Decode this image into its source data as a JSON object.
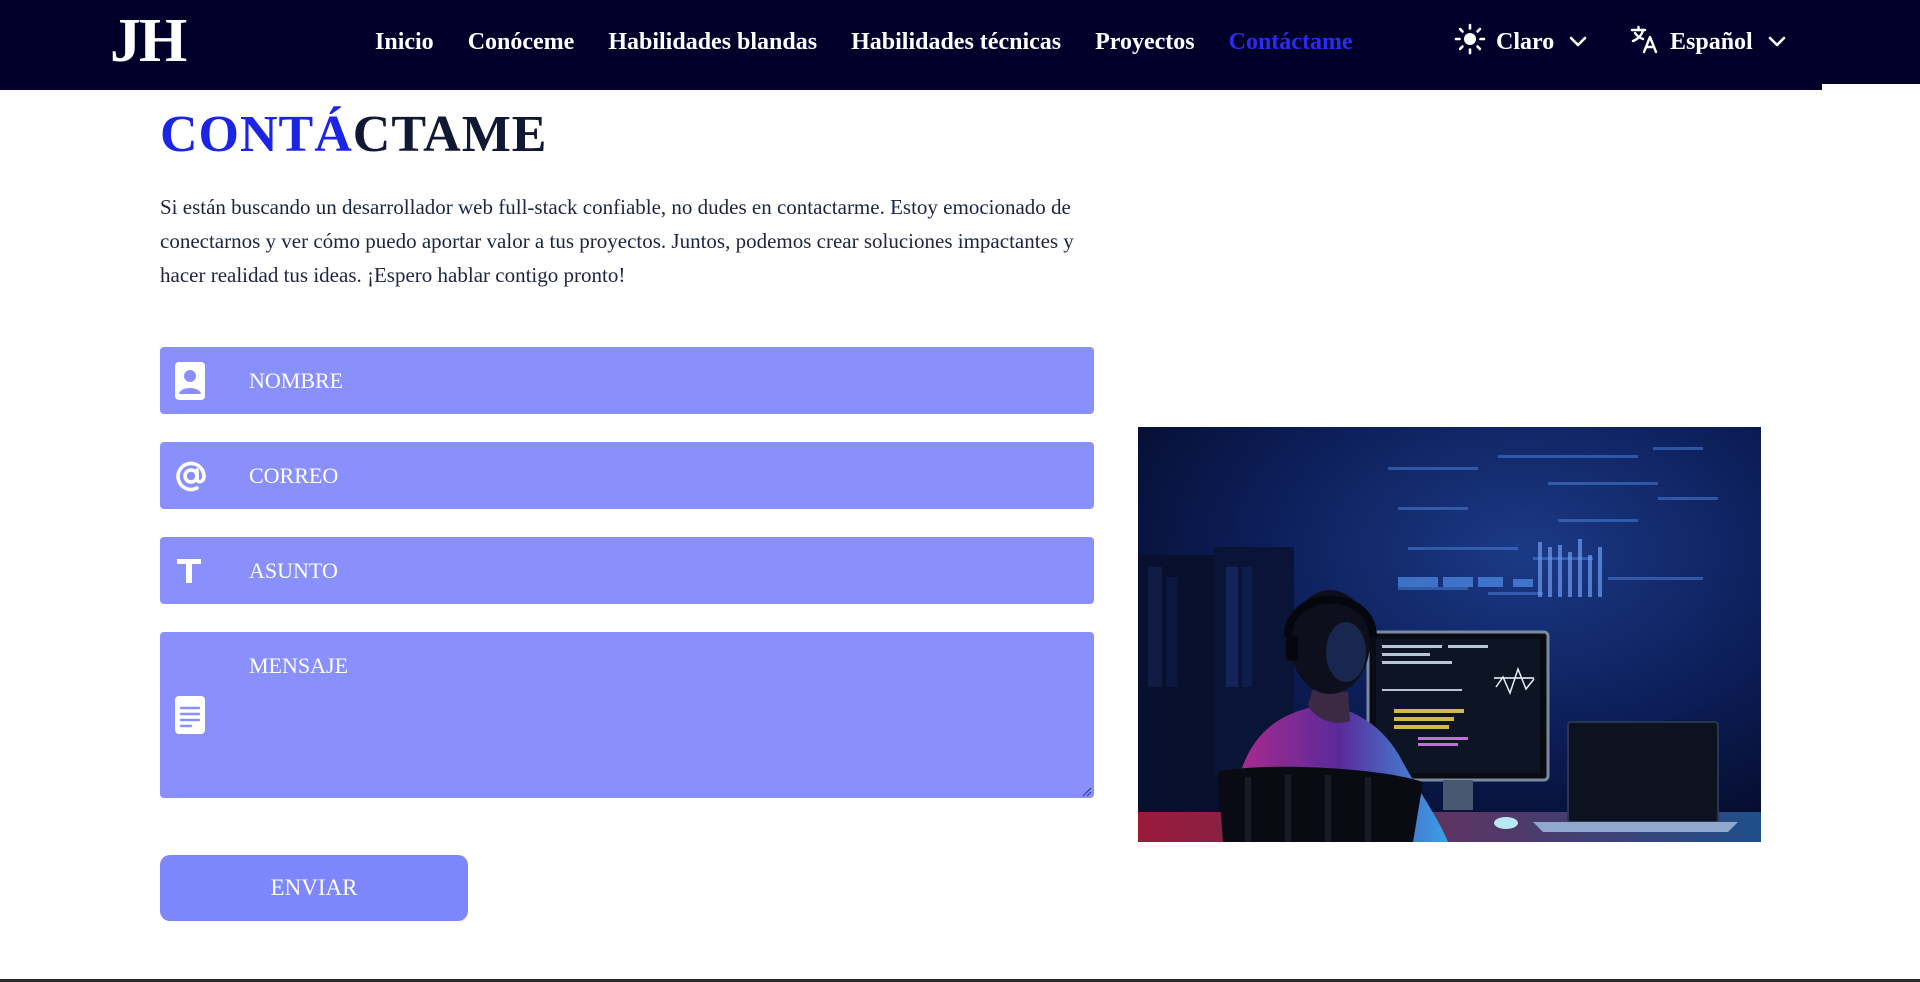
{
  "brand": {
    "logo": "JH"
  },
  "nav": {
    "items": [
      {
        "label": "Inicio",
        "active": false
      },
      {
        "label": "Conóceme",
        "active": false
      },
      {
        "label": "Habilidades blandas",
        "active": false
      },
      {
        "label": "Habilidades técnicas",
        "active": false
      },
      {
        "label": "Proyectos",
        "active": false
      },
      {
        "label": "Contáctame",
        "active": true
      }
    ],
    "theme": {
      "label": "Claro",
      "icon": "sun-icon"
    },
    "language": {
      "label": "Español",
      "icon": "translate-icon"
    }
  },
  "contact": {
    "title_accent": "CONTÁ",
    "title_rest": "CTAME",
    "intro": "Si están buscando un desarrollador web full-stack confiable, no dudes en contactarme. Estoy emocionado de conectarnos y ver cómo puedo aportar valor a tus proyectos. Juntos, podemos crear soluciones impactantes y hacer realidad tus ideas. ¡Espero hablar contigo pronto!",
    "fields": {
      "name": {
        "placeholder": "NOMBRE",
        "icon": "user-icon"
      },
      "email": {
        "placeholder": "CORREO",
        "icon": "at-sign-icon"
      },
      "subject": {
        "placeholder": "ASUNTO",
        "icon": "text-icon"
      },
      "message": {
        "placeholder": "MENSAJE",
        "icon": "document-icon"
      }
    },
    "submit_label": "ENVIAR"
  },
  "colors": {
    "nav_bg": "#02002a",
    "accent": "#1c24e6",
    "field_bg": "#8990fb",
    "button_bg": "#7e86fb"
  }
}
